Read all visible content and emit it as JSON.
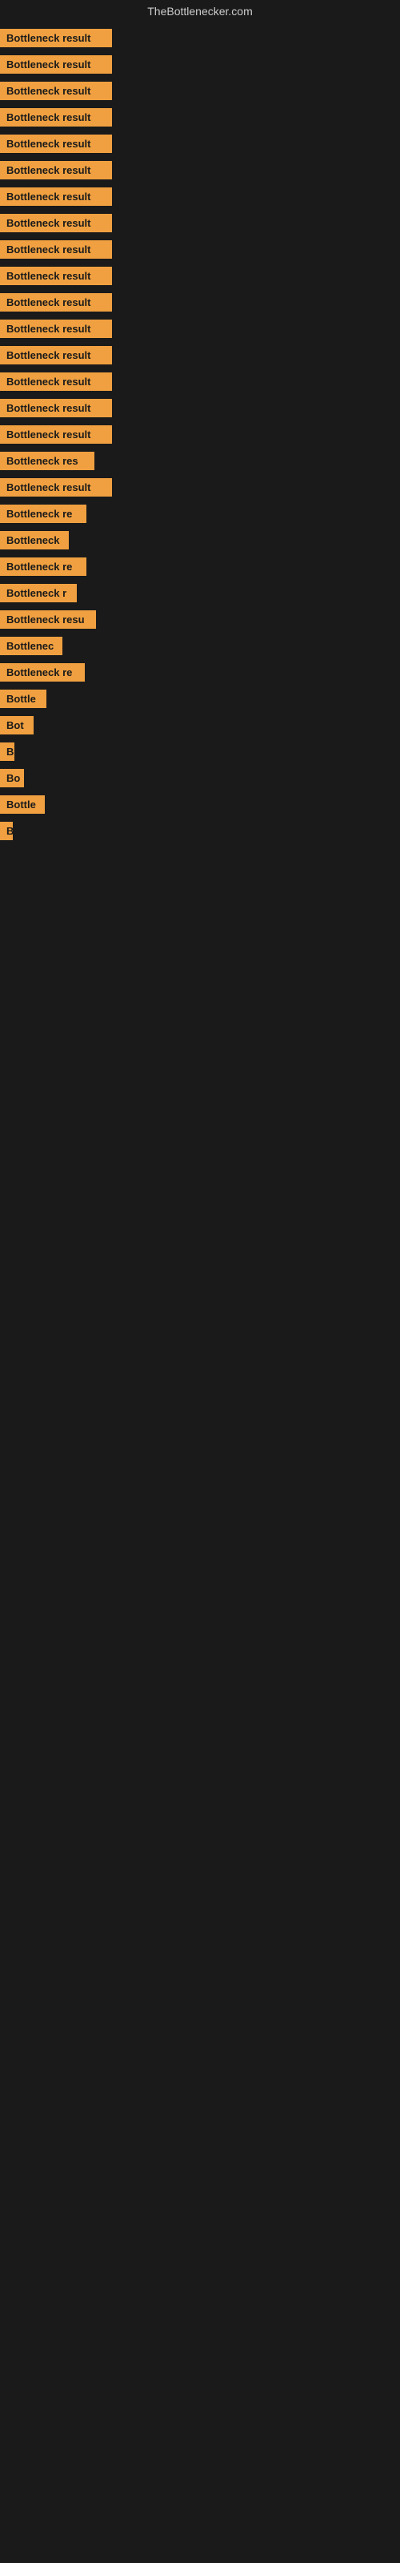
{
  "site": {
    "title": "TheBottlenecker.com"
  },
  "items": [
    {
      "label": "Bottleneck result",
      "width": 140
    },
    {
      "label": "Bottleneck result",
      "width": 140
    },
    {
      "label": "Bottleneck result",
      "width": 140
    },
    {
      "label": "Bottleneck result",
      "width": 140
    },
    {
      "label": "Bottleneck result",
      "width": 140
    },
    {
      "label": "Bottleneck result",
      "width": 140
    },
    {
      "label": "Bottleneck result",
      "width": 140
    },
    {
      "label": "Bottleneck result",
      "width": 140
    },
    {
      "label": "Bottleneck result",
      "width": 140
    },
    {
      "label": "Bottleneck result",
      "width": 140
    },
    {
      "label": "Bottleneck result",
      "width": 140
    },
    {
      "label": "Bottleneck result",
      "width": 140
    },
    {
      "label": "Bottleneck result",
      "width": 140
    },
    {
      "label": "Bottleneck result",
      "width": 140
    },
    {
      "label": "Bottleneck result",
      "width": 140
    },
    {
      "label": "Bottleneck result",
      "width": 140
    },
    {
      "label": "Bottleneck res",
      "width": 118
    },
    {
      "label": "Bottleneck result",
      "width": 140
    },
    {
      "label": "Bottleneck re",
      "width": 108
    },
    {
      "label": "Bottleneck",
      "width": 86
    },
    {
      "label": "Bottleneck re",
      "width": 108
    },
    {
      "label": "Bottleneck r",
      "width": 96
    },
    {
      "label": "Bottleneck resu",
      "width": 120
    },
    {
      "label": "Bottlenec",
      "width": 78
    },
    {
      "label": "Bottleneck re",
      "width": 106
    },
    {
      "label": "Bottle",
      "width": 58
    },
    {
      "label": "Bot",
      "width": 42
    },
    {
      "label": "B",
      "width": 18
    },
    {
      "label": "Bo",
      "width": 30
    },
    {
      "label": "Bottle",
      "width": 56
    },
    {
      "label": "B",
      "width": 14
    }
  ]
}
